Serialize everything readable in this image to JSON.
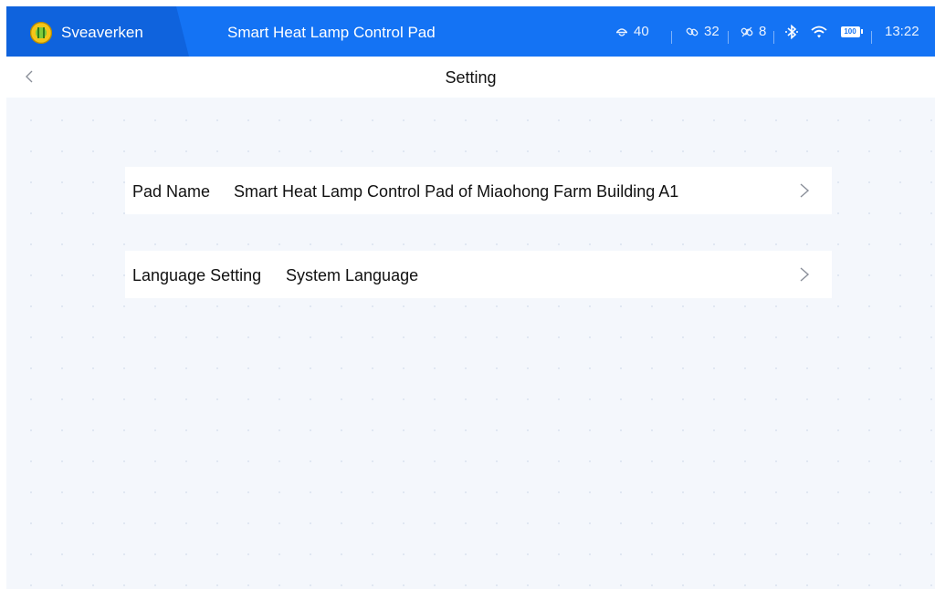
{
  "status_bar": {
    "brand": "Sveaverken",
    "app_title": "Smart Heat Lamp Control Pad",
    "indicators": [
      {
        "icon": "lamp-icon",
        "value": "40"
      },
      {
        "icon": "link-icon",
        "value": "32"
      },
      {
        "icon": "unlink-icon",
        "value": "8"
      }
    ],
    "battery": "100",
    "time": "13:22",
    "colors": {
      "bar": "#1473f4",
      "brand_tab": "#0f63dd"
    }
  },
  "header": {
    "title": "Setting",
    "back_icon": "chevron-left-icon"
  },
  "settings": [
    {
      "label": "Pad Name",
      "value": "Smart Heat Lamp Control Pad of Miaohong Farm Building A1"
    },
    {
      "label": "Language Setting",
      "value": "System Language"
    }
  ],
  "colors": {
    "background": "#f4f7fc",
    "card": "#ffffff"
  }
}
